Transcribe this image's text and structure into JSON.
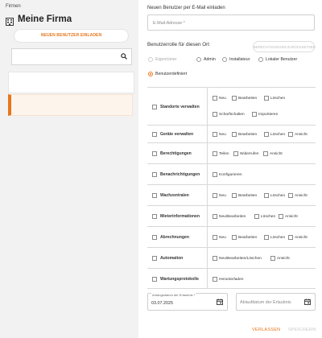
{
  "sidebar": {
    "breadcrumb": "Firmen",
    "company_name": "Meine Firma",
    "invite_button": "NEUEN BENUTZER EINLADEN",
    "search_placeholder": ""
  },
  "invite": {
    "heading": "Neuen Benutzer per E-Mail einladen",
    "email_label": "E-Mail-Adresse *",
    "role_heading": "Benutzerrolle für diesen Ort",
    "reset_button": "BERECHTIGUNGEN ZURÜCKSETZEN",
    "roles": [
      {
        "label": "Eigentümer",
        "state": "disabled"
      },
      {
        "label": "Admin",
        "state": "unchecked"
      },
      {
        "label": "Installateur",
        "state": "unchecked"
      },
      {
        "label": "Lokaler Benutzer",
        "state": "unchecked"
      },
      {
        "label": "Benutzerdefiniert",
        "state": "checked"
      }
    ]
  },
  "permissions": [
    {
      "category": "Standorte verwalten",
      "options": [
        "Neu",
        "Bearbeiten",
        "Löschen",
        "Scharfschalten",
        "Importieren"
      ]
    },
    {
      "category": "Geräte verwalten",
      "options": [
        "Neu",
        "Bearbeiten",
        "Löschen",
        "Ansicht"
      ]
    },
    {
      "category": "Berechtigungen",
      "options": [
        "Teilen",
        "Widerrufen",
        "Ansicht"
      ]
    },
    {
      "category": "Benachrichtigungen",
      "options": [
        "Konfigurieren"
      ]
    },
    {
      "category": "Wachzentralen",
      "options": [
        "Neu",
        "Bearbeiten",
        "Löschen",
        "Ansicht"
      ]
    },
    {
      "category": "Mieterinformationen",
      "options": [
        "Neu/Bearbeiten",
        "Löschen",
        "Ansicht"
      ]
    },
    {
      "category": "Abrechnungen",
      "options": [
        "Neu",
        "Bearbeiten",
        "Löschen",
        "Ansicht"
      ]
    },
    {
      "category": "Automation",
      "options": [
        "Neu/Bearbeiten/Löschen",
        "Ansicht"
      ]
    },
    {
      "category": "Wartungsprotokolle",
      "options": [
        "Herunterladen"
      ]
    }
  ],
  "dates": {
    "start_label": "Anfangsdatum der Erlaubnis *",
    "start_value": "03.07.2025",
    "end_placeholder": "Ablaufdatum der Erlaubnis"
  },
  "footer": {
    "leave": "VERLASSEN",
    "save": "SPEICHERN"
  },
  "colors": {
    "accent": "#e8761c",
    "sidebar_bg": "#f2f2f2"
  }
}
